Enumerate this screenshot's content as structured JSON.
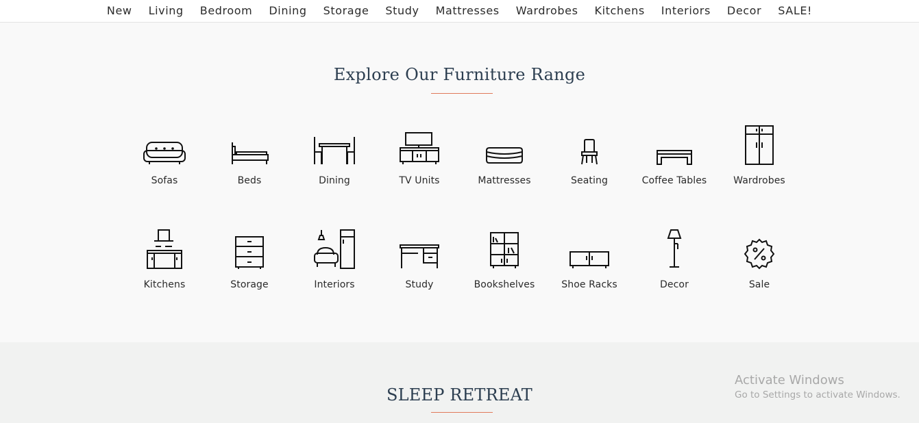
{
  "nav": {
    "items": [
      "New",
      "Living",
      "Bedroom",
      "Dining",
      "Storage",
      "Study",
      "Mattresses",
      "Wardrobes",
      "Kitchens",
      "Interiors",
      "Decor",
      "SALE!"
    ]
  },
  "explore": {
    "title": "Explore Our Furniture Range",
    "accent_color": "#e0795a",
    "categories_row1": [
      {
        "label": "Sofas",
        "icon": "sofa-icon"
      },
      {
        "label": "Beds",
        "icon": "bed-icon"
      },
      {
        "label": "Dining",
        "icon": "dining-table-icon"
      },
      {
        "label": "TV Units",
        "icon": "tv-unit-icon"
      },
      {
        "label": "Mattresses",
        "icon": "mattress-icon"
      },
      {
        "label": "Seating",
        "icon": "chair-icon"
      },
      {
        "label": "Coffee Tables",
        "icon": "coffee-table-icon"
      },
      {
        "label": "Wardrobes",
        "icon": "wardrobe-icon"
      }
    ],
    "categories_row2": [
      {
        "label": "Kitchens",
        "icon": "kitchen-icon"
      },
      {
        "label": "Storage",
        "icon": "drawer-cabinet-icon"
      },
      {
        "label": "Interiors",
        "icon": "interiors-icon"
      },
      {
        "label": "Study",
        "icon": "study-desk-icon"
      },
      {
        "label": "Bookshelves",
        "icon": "bookshelf-icon"
      },
      {
        "label": "Shoe Racks",
        "icon": "shoe-rack-icon"
      },
      {
        "label": "Decor",
        "icon": "floor-lamp-icon"
      },
      {
        "label": "Sale",
        "icon": "sale-badge-icon"
      }
    ]
  },
  "sleep": {
    "title": "SLEEP RETREAT"
  },
  "watermark": {
    "line1": "Activate Windows",
    "line2": "Go to Settings to activate Windows."
  },
  "colors": {
    "heading": "#2c3e50",
    "section_bg": "#f9f9f9",
    "section2_bg": "#f1f2f1"
  }
}
